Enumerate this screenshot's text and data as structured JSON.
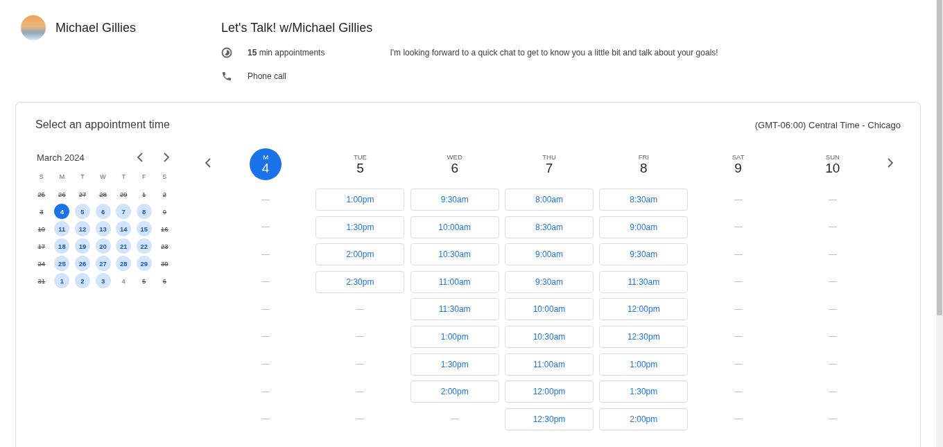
{
  "host": {
    "name": "Michael Gillies"
  },
  "event": {
    "title": "Let's Talk! w/Michael Gillies",
    "duration": "**15** min appointments",
    "location": "Phone call",
    "description": "I'm looking forward to a quick chat to get to know you a little bit and talk about your goals!"
  },
  "booking": {
    "heading": "Select an appointment time",
    "timezone": "(GMT-06:00) Central Time - Chicago"
  },
  "mini_calendar": {
    "month": "March 2024",
    "weekdays": [
      "S",
      "M",
      "T",
      "W",
      "T",
      "F",
      "S"
    ],
    "days": [
      {
        "label": "25",
        "kind": "unavailable",
        "selected": false
      },
      {
        "label": "26",
        "kind": "unavailable",
        "selected": false
      },
      {
        "label": "27",
        "kind": "unavailable",
        "selected": false
      },
      {
        "label": "28",
        "kind": "unavailable",
        "selected": false
      },
      {
        "label": "29",
        "kind": "unavailable",
        "selected": false
      },
      {
        "label": "1",
        "kind": "unavailable",
        "selected": false
      },
      {
        "label": "2",
        "kind": "unavailable",
        "selected": false
      },
      {
        "label": "3",
        "kind": "unavailable",
        "selected": false
      },
      {
        "label": "4",
        "kind": "available",
        "selected": true
      },
      {
        "label": "5",
        "kind": "available",
        "selected": false
      },
      {
        "label": "6",
        "kind": "available",
        "selected": false
      },
      {
        "label": "7",
        "kind": "available",
        "selected": false
      },
      {
        "label": "8",
        "kind": "available",
        "selected": false
      },
      {
        "label": "9",
        "kind": "unavailable",
        "selected": false
      },
      {
        "label": "10",
        "kind": "unavailable",
        "selected": false
      },
      {
        "label": "11",
        "kind": "available",
        "selected": false
      },
      {
        "label": "12",
        "kind": "available",
        "selected": false
      },
      {
        "label": "13",
        "kind": "available",
        "selected": false
      },
      {
        "label": "14",
        "kind": "available",
        "selected": false
      },
      {
        "label": "15",
        "kind": "available",
        "selected": false
      },
      {
        "label": "16",
        "kind": "unavailable",
        "selected": false
      },
      {
        "label": "17",
        "kind": "unavailable",
        "selected": false
      },
      {
        "label": "18",
        "kind": "available",
        "selected": false
      },
      {
        "label": "19",
        "kind": "available",
        "selected": false
      },
      {
        "label": "20",
        "kind": "available",
        "selected": false
      },
      {
        "label": "21",
        "kind": "available",
        "selected": false
      },
      {
        "label": "22",
        "kind": "available",
        "selected": false
      },
      {
        "label": "23",
        "kind": "unavailable",
        "selected": false
      },
      {
        "label": "24",
        "kind": "unavailable",
        "selected": false
      },
      {
        "label": "25",
        "kind": "available",
        "selected": false
      },
      {
        "label": "26",
        "kind": "available",
        "selected": false
      },
      {
        "label": "27",
        "kind": "available",
        "selected": false
      },
      {
        "label": "28",
        "kind": "available",
        "selected": false
      },
      {
        "label": "29",
        "kind": "available",
        "selected": false
      },
      {
        "label": "30",
        "kind": "unavailable",
        "selected": false
      },
      {
        "label": "31",
        "kind": "unavailable",
        "selected": false
      },
      {
        "label": "1",
        "kind": "available",
        "selected": false
      },
      {
        "label": "2",
        "kind": "available",
        "selected": false
      },
      {
        "label": "3",
        "kind": "available",
        "selected": false
      },
      {
        "label": "4",
        "kind": "plain",
        "selected": false
      },
      {
        "label": "5",
        "kind": "unavailable",
        "selected": false
      },
      {
        "label": "6",
        "kind": "unavailable",
        "selected": false
      }
    ]
  },
  "week": [
    {
      "weekday": "M",
      "date": "4",
      "selected": true
    },
    {
      "weekday": "TUE",
      "date": "5",
      "selected": false,
      "slots": [
        "1:00pm",
        "1:30pm",
        "2:00pm",
        "2:30pm"
      ]
    },
    {
      "weekday": "WED",
      "date": "6",
      "selected": false,
      "slots": [
        "9:30am",
        "10:00am",
        "10:30am",
        "11:00am",
        "11:30am",
        "1:00pm",
        "1:30pm",
        "2:00pm"
      ]
    },
    {
      "weekday": "THU",
      "date": "7",
      "selected": false,
      "slots": [
        "8:00am",
        "8:30am",
        "9:00am",
        "9:30am",
        "10:00am",
        "10:30am",
        "11:00am",
        "12:00pm",
        "12:30pm"
      ]
    },
    {
      "weekday": "FRI",
      "date": "8",
      "selected": false,
      "slots": [
        "8:30am",
        "9:00am",
        "9:30am",
        "11:30am",
        "12:00pm",
        "12:30pm",
        "1:00pm",
        "1:30pm",
        "2:00pm"
      ]
    },
    {
      "weekday": "SAT",
      "date": "9",
      "selected": false
    },
    {
      "weekday": "SUN",
      "date": "10",
      "selected": false
    }
  ]
}
